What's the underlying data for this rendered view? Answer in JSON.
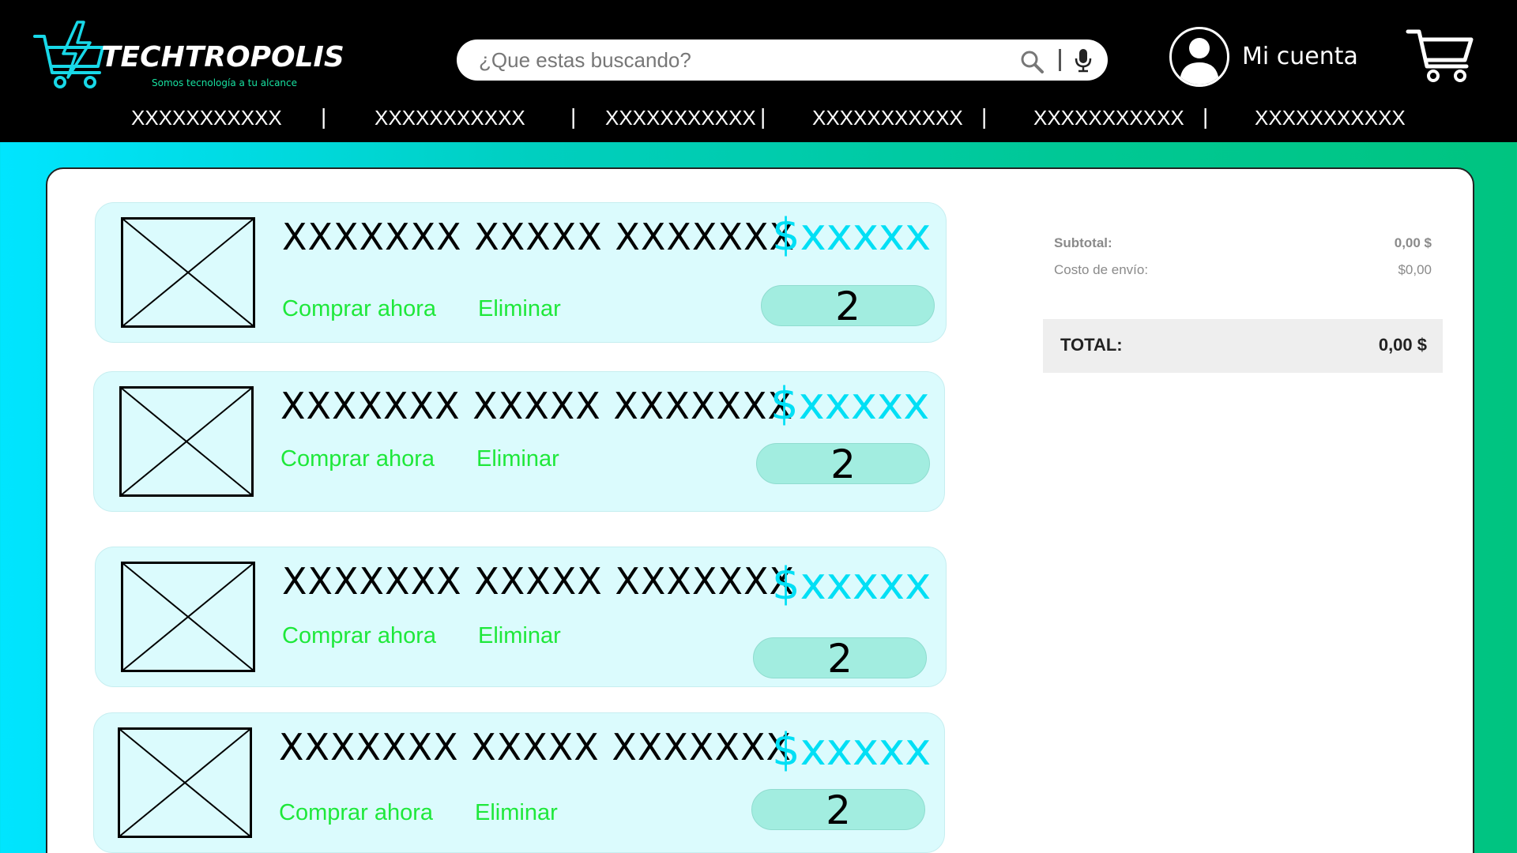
{
  "colors": {
    "header_bg": "#000000",
    "accent_cyan": "#00dff5",
    "accent_green": "#1ee83a",
    "card_bg": "#dbfbfd",
    "qty_bg": "#a2ede0",
    "brand_teal": "#18e0a0"
  },
  "brand": {
    "name": "TECHTROPOLIS",
    "tagline": "Somos tecnología a tu alcance",
    "logo_icon": "cart-bolt-logo"
  },
  "search": {
    "placeholder": "¿Que estas buscando?",
    "search_icon": "search-icon",
    "mic_icon": "mic-icon"
  },
  "account": {
    "label": "Mi cuenta",
    "icon": "user-avatar-icon"
  },
  "cart": {
    "icon": "cart-icon"
  },
  "nav": {
    "items": [
      {
        "label": "XXXXXXXXXXX"
      },
      {
        "label": "XXXXXXXXXXX"
      },
      {
        "label": "XXXXXXXXXXX"
      },
      {
        "label": "XXXXXXXXXXX"
      },
      {
        "label": "XXXXXXXXXXX"
      },
      {
        "label": "XXXXXXXXXXX"
      }
    ],
    "separator": "|"
  },
  "cart_items": [
    {
      "title": "XXXXXXX XXXXX XXXXXXX",
      "price": "$xxxxx",
      "buy_label": "Comprar ahora",
      "delete_label": "Eliminar",
      "quantity": "2",
      "image_icon": "image-placeholder-icon"
    },
    {
      "title": "XXXXXXX XXXXX XXXXXXX",
      "price": "$xxxxx",
      "buy_label": "Comprar ahora",
      "delete_label": "Eliminar",
      "quantity": "2",
      "image_icon": "image-placeholder-icon"
    },
    {
      "title": "XXXXXXX XXXXX XXXXXXX",
      "price": "$xxxxx",
      "buy_label": "Comprar ahora",
      "delete_label": "Eliminar",
      "quantity": "2",
      "image_icon": "image-placeholder-icon"
    },
    {
      "title": "XXXXXXX XXXXX XXXXXXX",
      "price": "$xxxxx",
      "buy_label": "Comprar ahora",
      "delete_label": "Eliminar",
      "quantity": "2",
      "image_icon": "image-placeholder-icon"
    }
  ],
  "summary": {
    "subtotal_label": "Subtotal:",
    "subtotal_value": "0,00 $",
    "shipping_label": "Costo de envío:",
    "shipping_value": "$0,00",
    "total_label": "TOTAL:",
    "total_value": "0,00 $"
  }
}
